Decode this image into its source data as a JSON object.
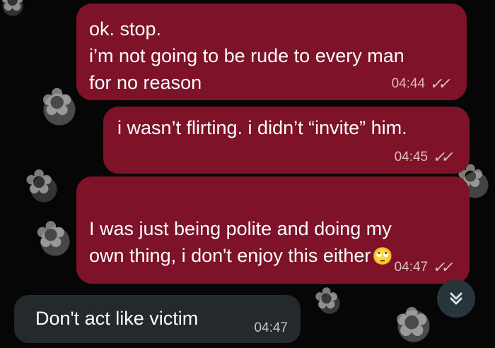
{
  "messages_outgoing": [
    {
      "text": "ok. stop.\ni’m not going to be rude to every man\nfor no reason",
      "time": "04:44",
      "status": "read"
    },
    {
      "text": "i wasn’t flirting. i didn’t “invite” him.",
      "time": "04:45",
      "status": "read"
    },
    {
      "text": "I was just being polite and doing my\nown thing, i don't enjoy this either",
      "emoji": "🙄",
      "time": "04:47",
      "status": "read"
    }
  ],
  "message_incoming": {
    "text": "Don't act like victim",
    "time": "04:47"
  },
  "scroll_down": {
    "icon": "double-chevron-down-icon"
  },
  "colors": {
    "outgoing_bubble": "#7d1228",
    "incoming_bubble": "#24292c",
    "background": "#050505",
    "text": "#ffffff",
    "meta": "#c8b7bb"
  }
}
